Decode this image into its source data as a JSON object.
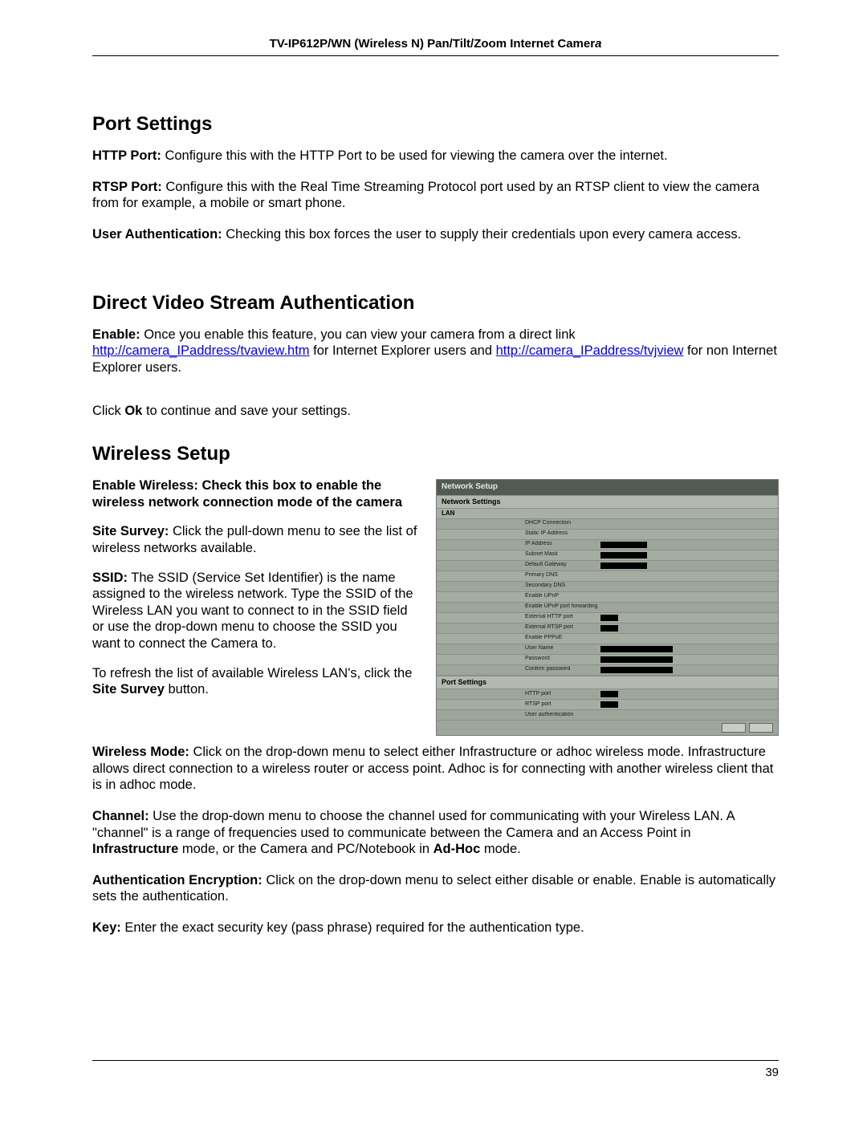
{
  "header": {
    "title_prefix": "TV-IP612P/WN (Wireless N) Pan/Tilt/Zoom Internet Camer",
    "title_italic": "a"
  },
  "sections": {
    "port_settings": {
      "heading": "Port Settings",
      "http_port_label": "HTTP Port:",
      "http_port_text": " Configure this with the HTTP Port to be used for viewing the camera over the internet.",
      "rtsp_port_label": "RTSP Port:",
      "rtsp_port_text": " Configure this with the Real Time Streaming Protocol port used by an RTSP client to view the camera from for example, a mobile or smart phone.",
      "user_auth_label": "User Authentication:",
      "user_auth_text": " Checking this box forces the user to supply their credentials upon every camera access."
    },
    "direct_video": {
      "heading": "Direct Video Stream Authentication",
      "enable_label": "Enable:",
      "enable_text_1": " Once you enable this feature, you can view your camera from a direct link ",
      "link_1": "http://camera_IPaddress/tvaview.htm",
      "enable_text_2": " for Internet Explorer users and ",
      "link_2": "http://camera_IPaddress/tvjview",
      "enable_text_3": " for non Internet Explorer users.",
      "click_ok_1": "Click ",
      "click_ok_bold": "Ok",
      "click_ok_2": " to continue and save your settings."
    },
    "wireless": {
      "heading": "Wireless Setup",
      "enable_wireless": "Enable Wireless: Check this box to enable the wireless network connection mode of the camera",
      "site_survey_label": "Site Survey:",
      "site_survey_text": " Click the pull-down menu to see the list of wireless networks available.",
      "ssid_label": "SSID:",
      "ssid_text": " The SSID (Service Set Identifier) is the name assigned to the wireless network. Type the SSID of the Wireless LAN you want to connect to in the SSID field or use the drop-down menu to choose the SSID you want to connect the Camera to.",
      "refresh_text_1": "To refresh the list of available Wireless LAN's, click the ",
      "refresh_bold": "Site Survey",
      "refresh_text_2": " button.",
      "wmode_label": "Wireless Mode:",
      "wmode_text": " Click on the drop-down menu to select either Infrastructure or adhoc wireless mode. Infrastructure allows direct connection to a wireless router or access point. Adhoc is for connecting with another wireless client that is in adhoc mode.",
      "channel_label": "Channel:",
      "channel_text_1": " Use the drop-down menu to choose the channel used for communicating with your Wireless LAN. A \"channel\" is a range of frequencies used to communicate between the Camera and an Access Point in ",
      "channel_bold_1": "Infrastructure",
      "channel_text_2": " mode, or the Camera and PC/Notebook in ",
      "channel_bold_2": "Ad-Hoc",
      "channel_text_3": " mode.",
      "authenc_label": "Authentication Encryption:",
      "authenc_text": " Click on the drop-down menu to select either disable or enable. Enable is automatically sets the authentication.",
      "key_label": "Key:",
      "key_text": " Enter the exact security key (pass phrase) required for the authentication type."
    }
  },
  "figure": {
    "title": "Network Setup",
    "subtitle": "Network Settings",
    "lan": "LAN",
    "port_settings": "Port Settings",
    "rows": [
      {
        "label": "DHCP Connection"
      },
      {
        "label": "Static IP Address"
      },
      {
        "label": "IP Address",
        "input": "w60"
      },
      {
        "label": "Subnet Mask",
        "input": "w60"
      },
      {
        "label": "Default Gateway",
        "input": "w60"
      },
      {
        "label": "Primary DNS"
      },
      {
        "label": "Secondary DNS"
      },
      {
        "label": "Enable UPnP"
      },
      {
        "label": "Enable UPnP port forwarding"
      },
      {
        "label": "External HTTP port",
        "input": "w25"
      },
      {
        "label": "External RTSP port",
        "input": "w25"
      },
      {
        "label": "Enable PPPoE"
      },
      {
        "label": "User Name",
        "input": "w90"
      },
      {
        "label": "Password",
        "input": "w90"
      },
      {
        "label": "Confirm password",
        "input": "w90"
      }
    ],
    "port_rows": [
      {
        "label": "HTTP port",
        "input": "w25"
      },
      {
        "label": "RTSP port",
        "input": "w25"
      },
      {
        "label": "User authentication"
      }
    ]
  },
  "page_number": "39"
}
